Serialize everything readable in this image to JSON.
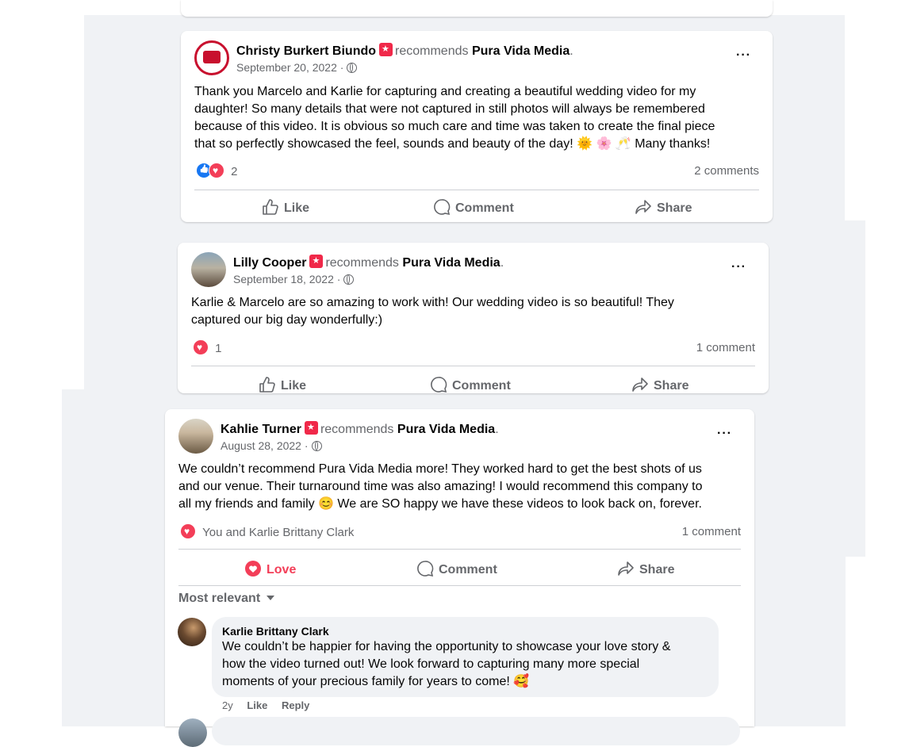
{
  "posts": [
    {
      "author": "Christy Burkert Biundo",
      "recommends": "recommends",
      "page": "Pura Vida Media",
      "date": "September 20, 2022 ·",
      "lines": [
        "Thank you Marcelo and Karlie for capturing and creating a beautiful wedding video for my",
        "daughter!  So many details that were not captured in still photos will always be remembered",
        "because of this video.  It is obvious so much care and time was taken to create the final piece",
        "that so perfectly showcased the feel, sounds and beauty of the day! 🌞 🌸  🥂 Many thanks!"
      ],
      "reaction_count": "2",
      "comments": "2 comments",
      "actions": [
        "Like",
        "Comment",
        "Share"
      ]
    },
    {
      "author": "Lilly Cooper",
      "recommends": "recommends",
      "page": "Pura Vida Media",
      "date": "September 18, 2022 ·",
      "lines": [
        "Karlie & Marcelo are so amazing to work with! Our wedding video is so beautiful! They",
        "captured our big day wonderfully:)"
      ],
      "reaction_count": "1",
      "comments": "1 comment",
      "actions": [
        "Like",
        "Comment",
        "Share"
      ]
    },
    {
      "author": "Kahlie Turner",
      "recommends": "recommends",
      "page": "Pura Vida Media",
      "date": "August 28, 2022 ·",
      "lines": [
        "We couldn’t recommend Pura Vida Media more! They worked hard to get the best shots of us",
        "and our venue. Their turnaround time was also amazing! I would recommend this company to",
        "all my friends and family 😊 We are SO happy we have these videos to look back on, forever."
      ],
      "reaction_text": "You and Karlie Brittany Clark",
      "comments": "1 comment",
      "actions": [
        "Love",
        "Comment",
        "Share"
      ],
      "sort_label": "Most relevant",
      "comment": {
        "author": "Karlie Brittany Clark",
        "lines": [
          "We couldn’t be happier for having the opportunity to showcase your love story &",
          "how the video turned out! We look forward to capturing many more special",
          "moments of your precious family for years to come! 🥰"
        ],
        "age": "2y",
        "like": "Like",
        "reply": "Reply"
      }
    }
  ],
  "colors": {
    "accent_love": "#f33e58",
    "like_blue": "#1877f2",
    "muted": "#65676b",
    "panel_bg": "#f0f2f5"
  }
}
